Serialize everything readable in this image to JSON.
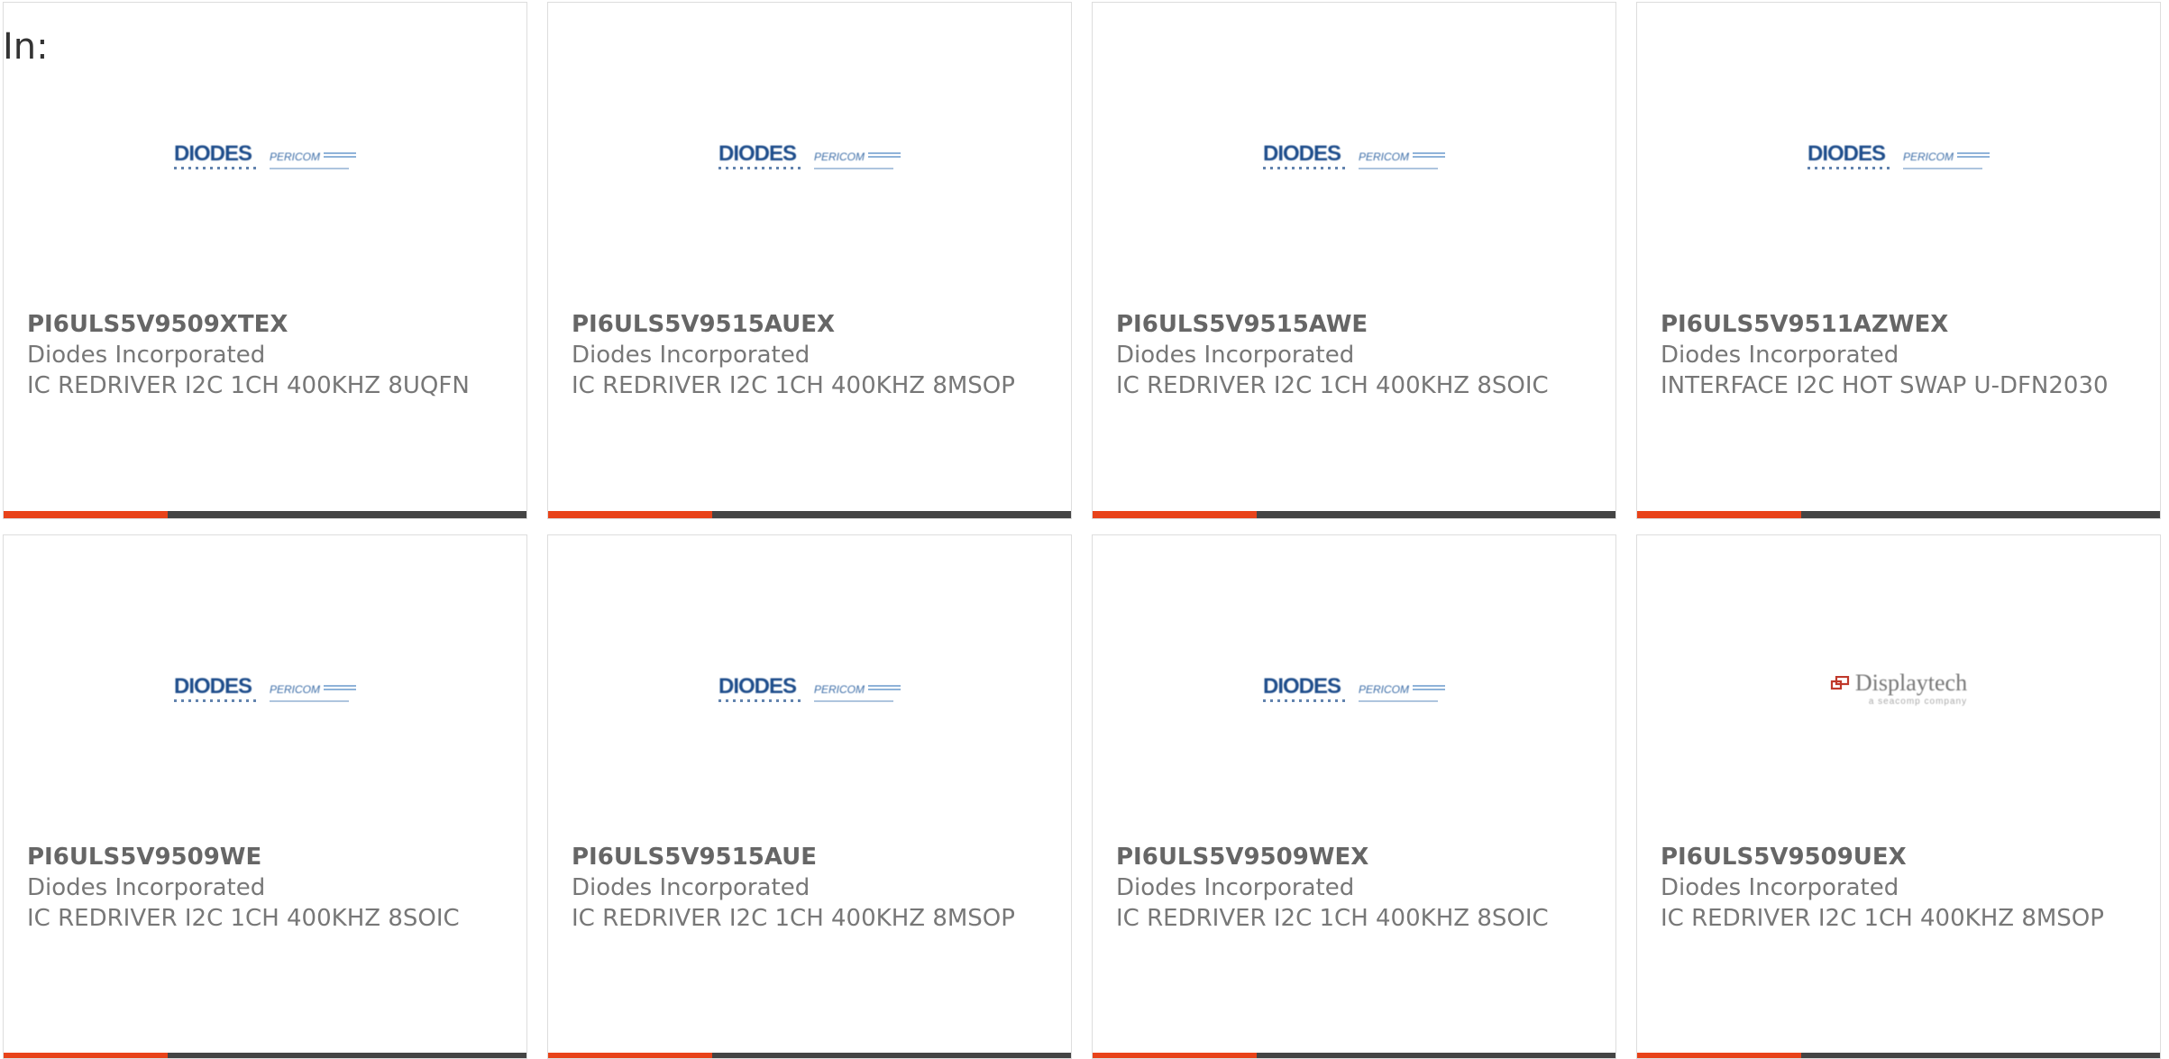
{
  "header": {
    "in_label": "In:"
  },
  "brand": {
    "accent_color": "#e8431a",
    "bar_color": "#444444"
  },
  "logos": {
    "diodes": {
      "word": "DIODES",
      "partner": "PERICOM"
    },
    "displaytech": {
      "word": "Displaytech",
      "tagline": "a seacomp company"
    }
  },
  "products": [
    {
      "part": "PI6ULS5V9509XTEX",
      "manufacturer": "Diodes Incorporated",
      "description": "IC REDRIVER I2C 1CH 400KHZ 8UQFN",
      "logo": "diodes"
    },
    {
      "part": "PI6ULS5V9515AUEX",
      "manufacturer": "Diodes Incorporated",
      "description": "IC REDRIVER I2C 1CH 400KHZ 8MSOP",
      "logo": "diodes"
    },
    {
      "part": "PI6ULS5V9515AWE",
      "manufacturer": "Diodes Incorporated",
      "description": "IC REDRIVER I2C 1CH 400KHZ 8SOIC",
      "logo": "diodes"
    },
    {
      "part": "PI6ULS5V9511AZWEX",
      "manufacturer": "Diodes Incorporated",
      "description": "INTERFACE I2C HOT SWAP U-DFN2030",
      "logo": "diodes"
    },
    {
      "part": "PI6ULS5V9509WE",
      "manufacturer": "Diodes Incorporated",
      "description": "IC REDRIVER I2C 1CH 400KHZ 8SOIC",
      "logo": "diodes"
    },
    {
      "part": "PI6ULS5V9515AUE",
      "manufacturer": "Diodes Incorporated",
      "description": "IC REDRIVER I2C 1CH 400KHZ 8MSOP",
      "logo": "diodes"
    },
    {
      "part": "PI6ULS5V9509WEX",
      "manufacturer": "Diodes Incorporated",
      "description": "IC REDRIVER I2C 1CH 400KHZ 8SOIC",
      "logo": "diodes"
    },
    {
      "part": "PI6ULS5V9509UEX",
      "manufacturer": "Diodes Incorporated",
      "description": "IC REDRIVER I2C 1CH 400KHZ 8MSOP",
      "logo": "displaytech"
    }
  ]
}
